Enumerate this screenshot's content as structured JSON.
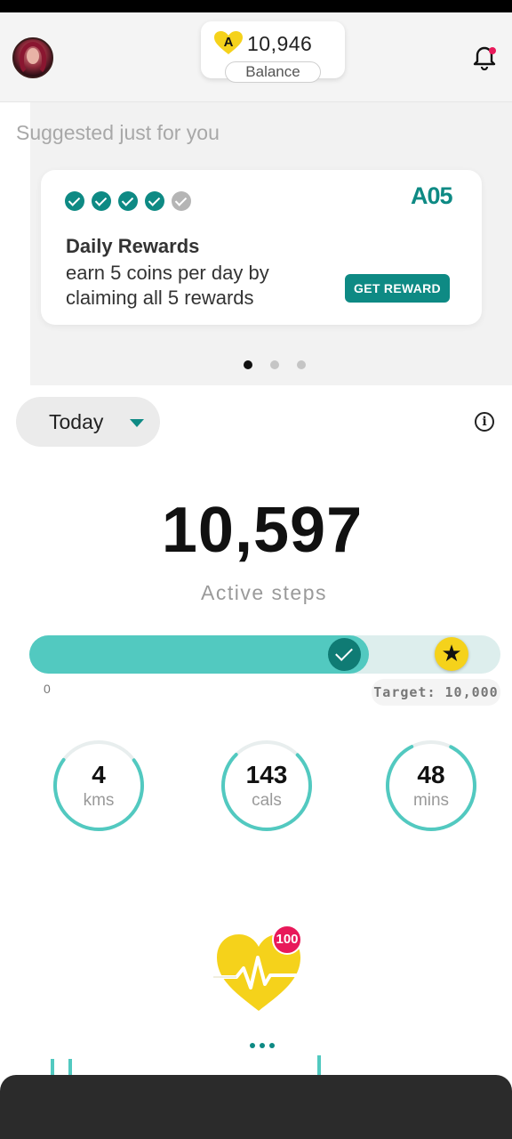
{
  "header": {
    "balance_amount": "10,946",
    "balance_label": "Balance",
    "coin_icon": "heart-coin-icon",
    "notification_icon": "bell-icon",
    "notification_dot_color": "#e8195a"
  },
  "suggested": {
    "title": "Suggested just for you",
    "card": {
      "checks_done": 4,
      "checks_total": 5,
      "amount": "A05",
      "title": "Daily Rewards",
      "description": "earn 5 coins per day by claiming all 5 rewards",
      "button_label": "GET REWARD"
    },
    "pager": {
      "pages": 3,
      "active": 0
    }
  },
  "period": {
    "label": "Today"
  },
  "steps": {
    "value": "10,597",
    "label": "Active steps",
    "progress_min": "0",
    "target_label": "Target: 10,000",
    "progress_fraction": 0.72
  },
  "stats": [
    {
      "value": "4",
      "unit": "kms",
      "fraction": 0.7
    },
    {
      "value": "143",
      "unit": "cals",
      "fraction": 0.75
    },
    {
      "value": "48",
      "unit": "mins",
      "fraction": 0.85
    }
  ],
  "heart": {
    "badge": "100"
  },
  "colors": {
    "accent": "#0e8a84",
    "progress": "#52c9c0",
    "star": "#f5d21b"
  }
}
